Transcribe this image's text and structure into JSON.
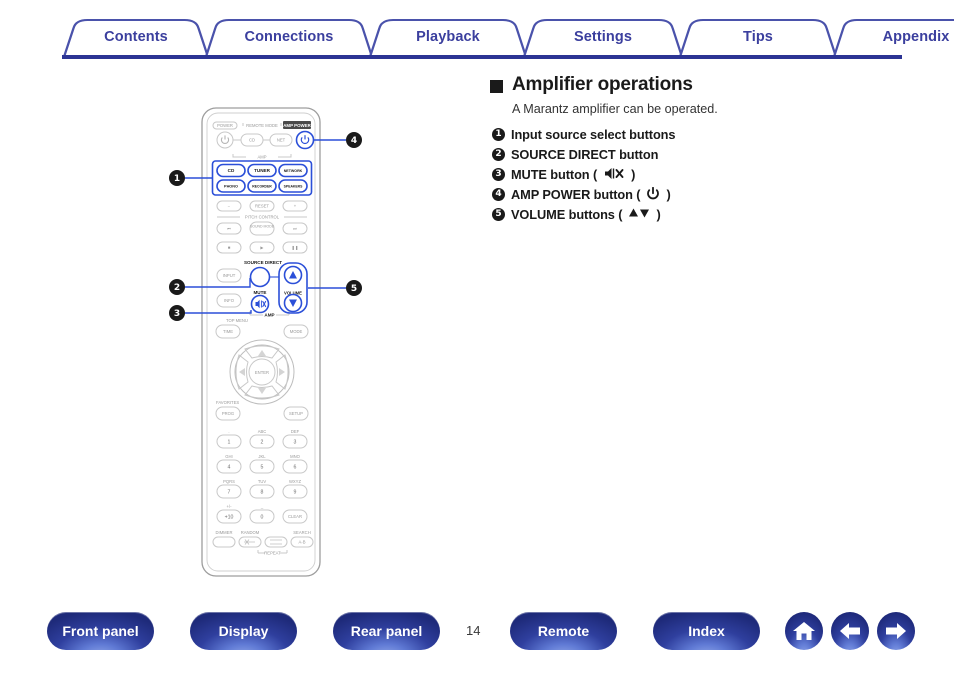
{
  "tabs": [
    {
      "label": "Contents",
      "name": "tab-contents"
    },
    {
      "label": "Connections",
      "name": "tab-connections"
    },
    {
      "label": "Playback",
      "name": "tab-playback"
    },
    {
      "label": "Settings",
      "name": "tab-settings"
    },
    {
      "label": "Tips",
      "name": "tab-tips"
    },
    {
      "label": "Appendix",
      "name": "tab-appendix"
    }
  ],
  "content": {
    "heading": "Amplifier operations",
    "subtitle": "A Marantz amplifier can be operated.",
    "callouts": [
      {
        "num": "1",
        "text": "Input source select buttons"
      },
      {
        "num": "2",
        "text": "SOURCE DIRECT button"
      },
      {
        "num": "3",
        "text": "MUTE button (␣×)"
      },
      {
        "num": "4",
        "text": "AMP POWER button (⏻)"
      },
      {
        "num": "5",
        "text": "VOLUME buttons (▲▼)"
      }
    ],
    "callout_3_label": "MUTE button (",
    "callout_3_suffix": ")",
    "callout_4_label": "AMP POWER button (",
    "callout_4_suffix": ")",
    "callout_5_label": "VOLUME buttons (",
    "callout_5_suffix": ")"
  },
  "remote": {
    "markers": [
      "1",
      "2",
      "3",
      "4",
      "5"
    ],
    "labels": {
      "power": "POWER",
      "remote_mode": "REMOTE MODE",
      "remote_mode_cd": "CD",
      "remote_mode_net": "NET",
      "amp_power": "AMP POWER",
      "amp_group": "AMP",
      "src_cd": "CD",
      "src_tuner": "TUNER",
      "src_network": "NETWORK",
      "src_phono": "PHONO",
      "src_recorder": "RECORDER",
      "src_speakers": "SPEAKERS",
      "minus": "−",
      "reset": "RESET",
      "plus": "+",
      "pitch_control": "PITCH CONTROL",
      "prev": "⏮",
      "sound_mode": "SOUND MODE",
      "next": "⏭",
      "stop": "■",
      "play": "▶",
      "pause": "❚❚",
      "source_direct": "SOURCE DIRECT",
      "input": "INPUT",
      "info": "INFO",
      "mute": "MUTE",
      "volume": "VOLUME",
      "amp_bracket": "AMP",
      "top_menu": "TOP MENU",
      "time": "TIME",
      "mode": "MODE",
      "enter": "ENTER",
      "favorites": "FAVORITES",
      "prog": "PROG",
      "setup": "SETUP",
      "clear": "CLEAR",
      "dimmer": "DIMMER",
      "random": "RANDOM",
      "repeat": "REPEAT",
      "search": "SEARCH",
      "search_ab": "A-B",
      "plus10": "+10"
    },
    "keypad": [
      {
        "digit": "1",
        "alpha": "."
      },
      {
        "digit": "2",
        "alpha": "ABC"
      },
      {
        "digit": "3",
        "alpha": "DEF"
      },
      {
        "digit": "4",
        "alpha": "GHI"
      },
      {
        "digit": "5",
        "alpha": "JKL"
      },
      {
        "digit": "6",
        "alpha": "MNO"
      },
      {
        "digit": "7",
        "alpha": "PQRS"
      },
      {
        "digit": "8",
        "alpha": "TUV"
      },
      {
        "digit": "9",
        "alpha": "WXYZ"
      },
      {
        "digit": "+10",
        "alpha": "+/-"
      },
      {
        "digit": "0",
        "alpha": "_"
      },
      {
        "digit": "CLEAR",
        "alpha": ""
      }
    ]
  },
  "footer": {
    "buttons": [
      {
        "label": "Front panel",
        "name": "footer-front-panel"
      },
      {
        "label": "Display",
        "name": "footer-display"
      },
      {
        "label": "Rear panel",
        "name": "footer-rear-panel"
      },
      {
        "label": "Remote",
        "name": "footer-remote"
      },
      {
        "label": "Index",
        "name": "footer-index"
      }
    ],
    "page_number": "14",
    "icons": [
      {
        "name": "home-icon"
      },
      {
        "name": "arrow-left-icon"
      },
      {
        "name": "arrow-right-icon"
      }
    ]
  },
  "colors": {
    "tab_text": "#3b3f9e",
    "tab_rule": "#2c3494",
    "accent_blue": "#2b4fd8",
    "pill_dark": "#2f3f9e"
  }
}
